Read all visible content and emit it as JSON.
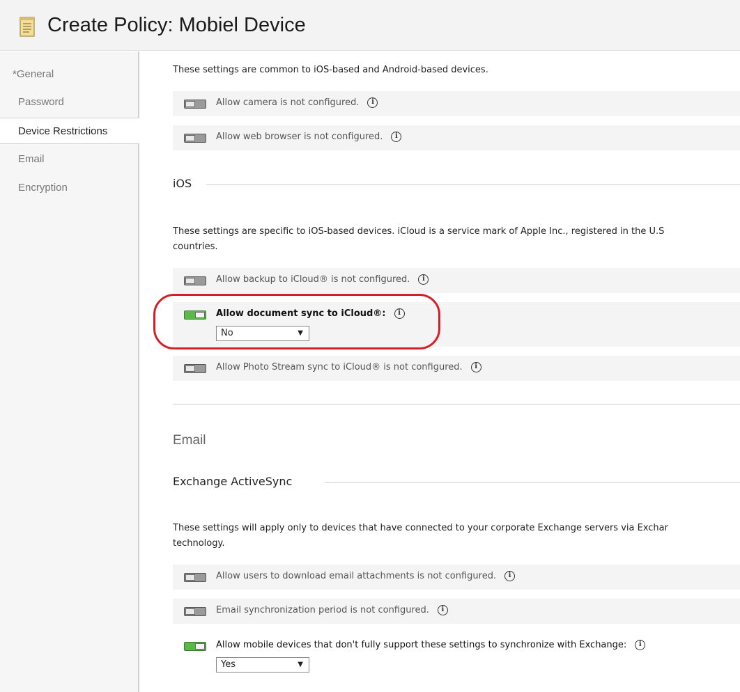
{
  "header": {
    "title": "Create Policy: Mobiel Device",
    "icon": "document-icon"
  },
  "sidebar": {
    "items": [
      {
        "label": "*General"
      },
      {
        "label": "Password"
      },
      {
        "label": "Device Restrictions",
        "selected": true
      },
      {
        "label": "Email"
      },
      {
        "label": "Encryption"
      }
    ]
  },
  "common": {
    "intro": "These settings are common to iOS-based and Android-based devices.",
    "settings": [
      {
        "label": "Allow camera is not configured.",
        "state": "off"
      },
      {
        "label": "Allow web browser is not configured.",
        "state": "off"
      }
    ]
  },
  "ios": {
    "heading": "iOS",
    "intro_line1": "These settings are specific to iOS-based devices. iCloud is a service mark of Apple Inc., registered in the U.S",
    "intro_line2": "countries.",
    "settings": [
      {
        "label": "Allow backup to iCloud® is not configured.",
        "state": "off"
      },
      {
        "label": "Allow document sync to iCloud®:",
        "state": "on",
        "value": "No"
      },
      {
        "label": "Allow Photo Stream sync to iCloud® is not configured.",
        "state": "off"
      }
    ]
  },
  "email": {
    "heading": "Email",
    "subheading": "Exchange ActiveSync",
    "intro_line1": "These settings will apply only to devices that have connected to your corporate Exchange servers via Exchar",
    "intro_line2": "technology.",
    "settings": [
      {
        "label": "Allow users to download email attachments is not configured.",
        "state": "off"
      },
      {
        "label": "Email synchronization period is not configured.",
        "state": "off"
      },
      {
        "label": "Allow mobile devices that don't fully support these settings to synchronize with Exchange:",
        "state": "on",
        "value": "Yes"
      }
    ]
  },
  "colors": {
    "toggle_on": "#5cb84b",
    "highlight": "#d41f26"
  },
  "icons": {
    "info": "info-icon",
    "dropdown": "chevron-down-icon"
  }
}
